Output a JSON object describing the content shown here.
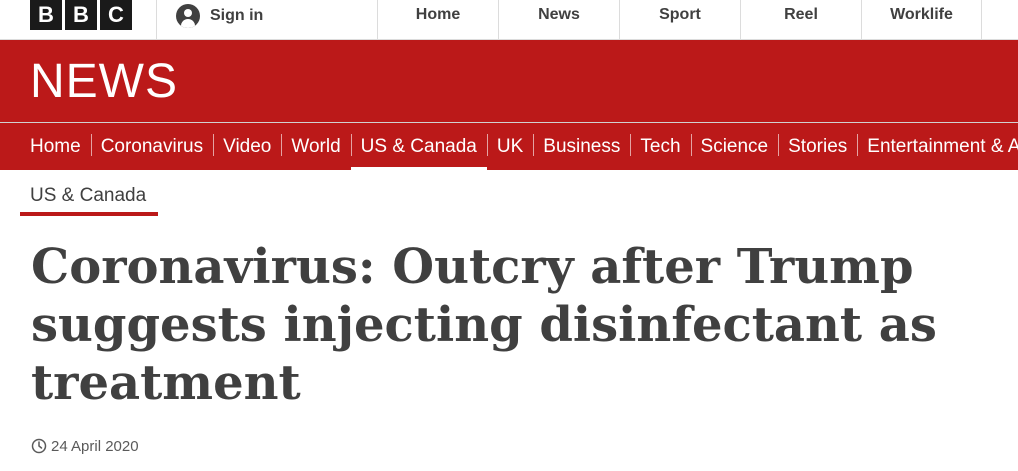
{
  "header": {
    "logo_letters": [
      "B",
      "B",
      "C"
    ],
    "signin_label": "Sign in",
    "global_nav": [
      "Home",
      "News",
      "Sport",
      "Reel",
      "Worklife"
    ]
  },
  "banner": {
    "wordmark": "NEWS",
    "color": "#bb1919"
  },
  "section_nav": {
    "items": [
      "Home",
      "Coronavirus",
      "Video",
      "World",
      "US & Canada",
      "UK",
      "Business",
      "Tech",
      "Science",
      "Stories",
      "Entertainment & Arts"
    ],
    "active": "US & Canada"
  },
  "article": {
    "section": "US & Canada",
    "headline": "Coronavirus: Outcry after Trump suggests injecting disinfectant as treatment",
    "date": "24 April 2020",
    "date_icon": "clock-icon"
  }
}
